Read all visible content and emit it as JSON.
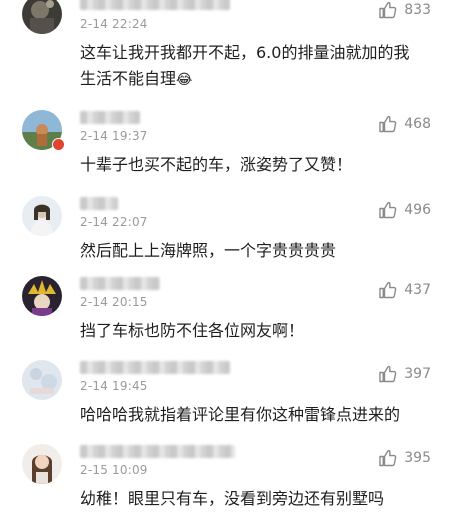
{
  "comments": [
    {
      "time": "2-14 22:24",
      "likes": "833",
      "text": "这车让我开我都开不起，6.0的排量油就加的我生活不能自理",
      "emoji": "😂",
      "avatar": "avatar-dark"
    },
    {
      "time": "2-14 19:37",
      "likes": "468",
      "text": "十辈子也买不起的车，涨姿势了又赞！",
      "avatar": "avatar-landscape"
    },
    {
      "time": "2-14 22:07",
      "likes": "496",
      "text": "然后配上上海牌照，一个字贵贵贵贵",
      "avatar": "avatar-person"
    },
    {
      "time": "2-14 20:15",
      "likes": "437",
      "text": "挡了车标也防不住各位网友啊！",
      "avatar": "avatar-cartoon"
    },
    {
      "time": "2-14 19:45",
      "likes": "397",
      "text": "哈哈哈我就指着评论里有你这种雷锋点进来的",
      "avatar": "avatar-pale"
    },
    {
      "time": "2-15 10:09",
      "likes": "395",
      "text": "幼稚！眼里只有车，没看到旁边还有别墅吗",
      "avatar": "avatar-face"
    }
  ],
  "icons": {
    "like": "thumbs-up-icon",
    "verified": "verified-badge"
  },
  "colors": {
    "meta": "#9a9a9a",
    "text": "#1e1e1e",
    "verified": "#e0432f"
  }
}
